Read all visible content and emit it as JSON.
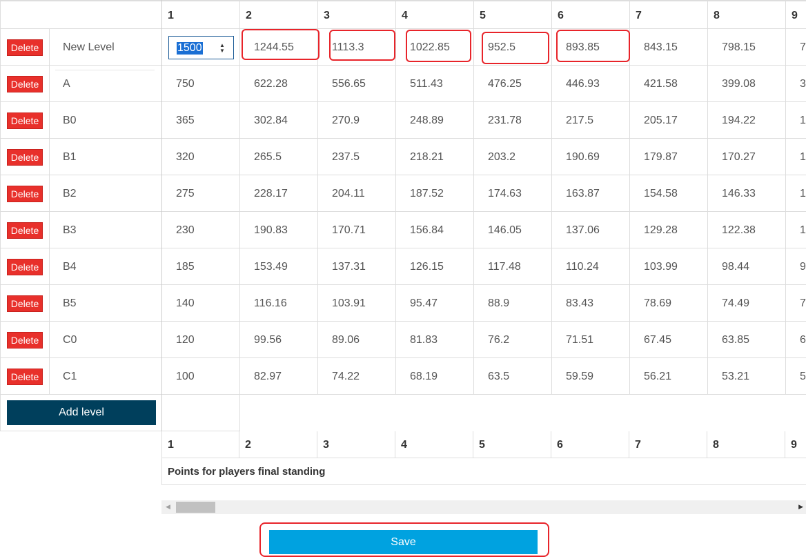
{
  "table": {
    "columns": [
      "1",
      "2",
      "3",
      "4",
      "5",
      "6",
      "7",
      "8",
      "9"
    ],
    "levels": [
      {
        "name": "New Level",
        "values": [
          "1500",
          "1244.55",
          "1113.3",
          "1022.85",
          "952.5",
          "893.85",
          "843.15",
          "798.15",
          "7"
        ]
      },
      {
        "name": "A",
        "values": [
          "750",
          "622.28",
          "556.65",
          "511.43",
          "476.25",
          "446.93",
          "421.58",
          "399.08",
          "3"
        ]
      },
      {
        "name": "B0",
        "values": [
          "365",
          "302.84",
          "270.9",
          "248.89",
          "231.78",
          "217.5",
          "205.17",
          "194.22",
          "1"
        ]
      },
      {
        "name": "B1",
        "values": [
          "320",
          "265.5",
          "237.5",
          "218.21",
          "203.2",
          "190.69",
          "179.87",
          "170.27",
          "1"
        ]
      },
      {
        "name": "B2",
        "values": [
          "275",
          "228.17",
          "204.11",
          "187.52",
          "174.63",
          "163.87",
          "154.58",
          "146.33",
          "1"
        ]
      },
      {
        "name": "B3",
        "values": [
          "230",
          "190.83",
          "170.71",
          "156.84",
          "146.05",
          "137.06",
          "129.28",
          "122.38",
          "1"
        ]
      },
      {
        "name": "B4",
        "values": [
          "185",
          "153.49",
          "137.31",
          "126.15",
          "117.48",
          "110.24",
          "103.99",
          "98.44",
          "9"
        ]
      },
      {
        "name": "B5",
        "values": [
          "140",
          "116.16",
          "103.91",
          "95.47",
          "88.9",
          "83.43",
          "78.69",
          "74.49",
          "7"
        ]
      },
      {
        "name": "C0",
        "values": [
          "120",
          "99.56",
          "89.06",
          "81.83",
          "76.2",
          "71.51",
          "67.45",
          "63.85",
          "6"
        ]
      },
      {
        "name": "C1",
        "values": [
          "100",
          "82.97",
          "74.22",
          "68.19",
          "63.5",
          "59.59",
          "56.21",
          "53.21",
          "5"
        ]
      }
    ],
    "delete_label": "Delete",
    "add_level_label": "Add level",
    "points_label": "Points for players final standing"
  },
  "save_label": "Save",
  "colors": {
    "delete": "#e8302b",
    "add_level": "#003f5c",
    "save": "#00a2e0",
    "highlight": "#e8242a"
  }
}
